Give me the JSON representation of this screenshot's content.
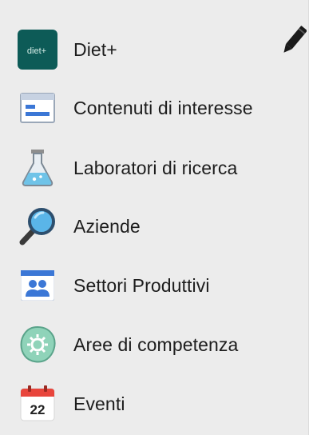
{
  "menu": {
    "items": [
      {
        "id": "diet",
        "label": "Diet+",
        "icon": "diet-logo-icon",
        "badge_text": "diet+"
      },
      {
        "id": "contenuti",
        "label": "Contenuti di interesse",
        "icon": "document-card-icon"
      },
      {
        "id": "laboratori",
        "label": "Laboratori di ricerca",
        "icon": "flask-icon"
      },
      {
        "id": "aziende",
        "label": "Aziende",
        "icon": "magnifier-icon"
      },
      {
        "id": "settori",
        "label": "Settori Produttivi",
        "icon": "people-group-icon"
      },
      {
        "id": "aree",
        "label": "Aree di competenza",
        "icon": "gear-shield-icon"
      },
      {
        "id": "eventi",
        "label": "Eventi",
        "icon": "calendar-icon",
        "calendar_day": "22"
      }
    ],
    "edit_icon": "pencil-icon"
  },
  "colors": {
    "panel_bg": "#ececec",
    "diet_tile": "#0d5b57",
    "calendar_red": "#e8453c",
    "blue_tile": "#3b77d6"
  }
}
